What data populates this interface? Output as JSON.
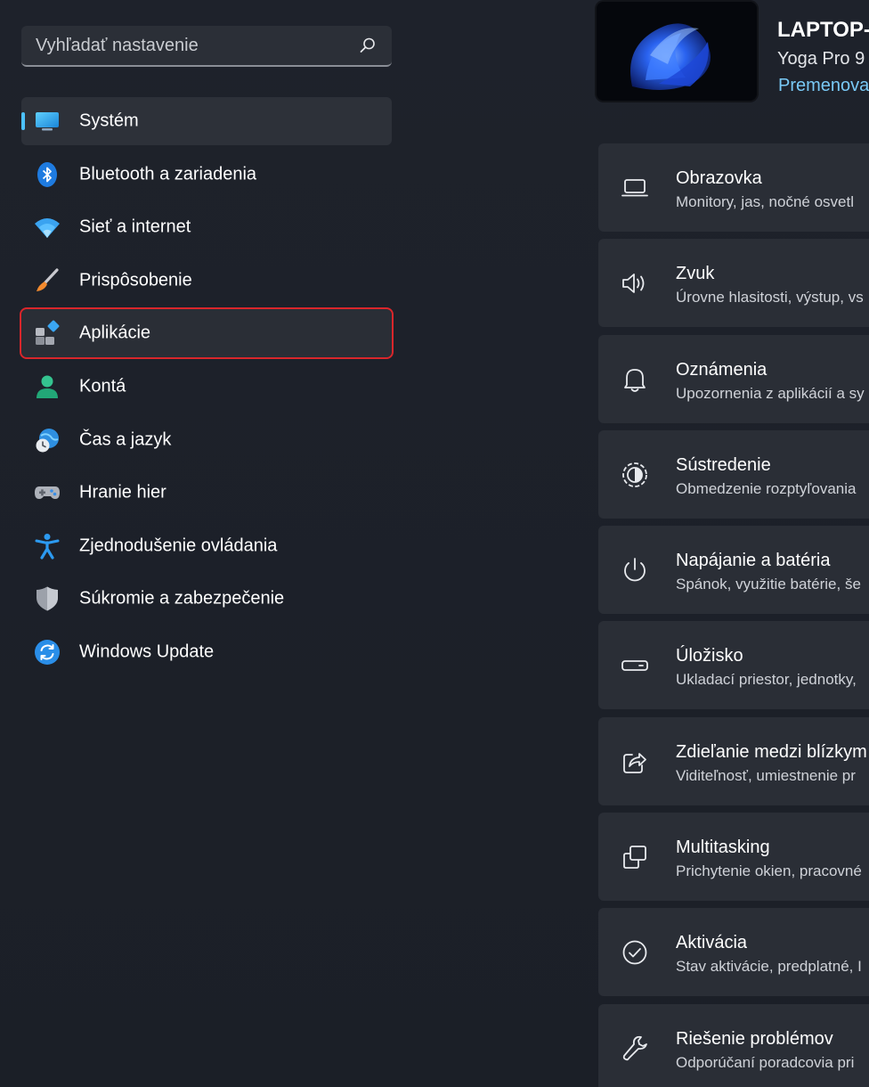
{
  "search": {
    "placeholder": "Vyhľadať nastavenie"
  },
  "accent_color": "#4cc2ff",
  "highlight_color": "#d9262b",
  "nav": {
    "items": [
      {
        "label": "Systém",
        "icon": "system-display-icon",
        "active": true
      },
      {
        "label": "Bluetooth a zariadenia",
        "icon": "bluetooth-icon"
      },
      {
        "label": "Sieť a internet",
        "icon": "wifi-icon"
      },
      {
        "label": "Prispôsobenie",
        "icon": "paintbrush-icon"
      },
      {
        "label": "Aplikácie",
        "icon": "apps-icon",
        "highlighted": true
      },
      {
        "label": "Kontá",
        "icon": "account-icon"
      },
      {
        "label": "Čas a jazyk",
        "icon": "time-language-icon"
      },
      {
        "label": "Hranie hier",
        "icon": "gamepad-icon"
      },
      {
        "label": "Zjednodušenie ovládania",
        "icon": "accessibility-icon"
      },
      {
        "label": "Súkromie a zabezpečenie",
        "icon": "shield-icon"
      },
      {
        "label": "Windows Update",
        "icon": "windows-update-icon"
      }
    ]
  },
  "device": {
    "name": "LAPTOP-",
    "model": "Yoga Pro 9",
    "rename_link": "Premenova"
  },
  "cards": [
    {
      "title": "Obrazovka",
      "subtitle": "Monitory, jas, nočné osvetl",
      "icon": "laptop-display-icon"
    },
    {
      "title": "Zvuk",
      "subtitle": "Úrovne hlasitosti, výstup, vs",
      "icon": "speaker-icon"
    },
    {
      "title": "Oznámenia",
      "subtitle": "Upozornenia z aplikácií a sy",
      "icon": "bell-icon"
    },
    {
      "title": "Sústredenie",
      "subtitle": "Obmedzenie rozptyľovania",
      "icon": "focus-icon"
    },
    {
      "title": "Napájanie a batéria",
      "subtitle": "Spánok, využitie batérie, še",
      "icon": "power-icon"
    },
    {
      "title": "Úložisko",
      "subtitle": "Ukladací priestor, jednotky,",
      "icon": "storage-icon"
    },
    {
      "title": "Zdieľanie medzi blízkym",
      "subtitle": "Viditeľnosť, umiestnenie pr",
      "icon": "nearby-share-icon"
    },
    {
      "title": "Multitasking",
      "subtitle": "Prichytenie okien, pracovné",
      "icon": "multitasking-icon"
    },
    {
      "title": "Aktivácia",
      "subtitle": "Stav aktivácie, predplatné, I",
      "icon": "activation-check-icon"
    },
    {
      "title": "Riešenie problémov",
      "subtitle": "Odporúčaní poradcovia pri",
      "icon": "wrench-icon"
    }
  ]
}
